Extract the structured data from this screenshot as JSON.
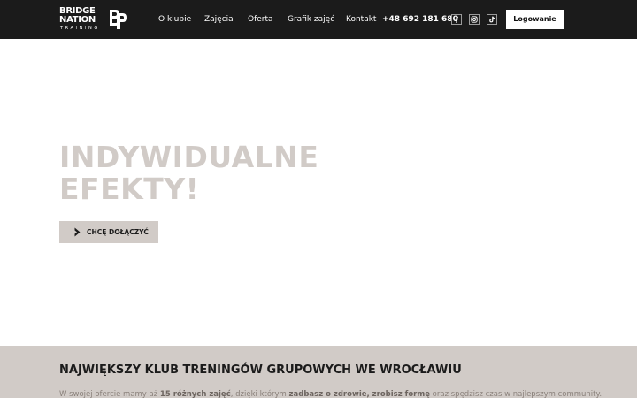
{
  "header": {
    "logo": {
      "line1": "BRIDGE",
      "line2": "NATION",
      "sub": "TRAINING"
    },
    "nav": [
      {
        "label": "O klubie"
      },
      {
        "label": "Zajęcia"
      },
      {
        "label": "Oferta"
      },
      {
        "label": "Grafik zajęć"
      },
      {
        "label": "Kontakt"
      }
    ],
    "phone": "+48 692 181 680",
    "social": [
      {
        "icon": "facebook-icon"
      },
      {
        "icon": "instagram-icon"
      },
      {
        "icon": "tiktok-icon"
      }
    ],
    "login_label": "Logowanie"
  },
  "hero": {
    "title_line1": "INDYWIDUALNE",
    "title_line2": "EFEKTY!",
    "cta_label": "CHCĘ DOŁĄCZYĆ"
  },
  "section": {
    "title": "NAJWIĘKSZY KLUB TRENINGÓW GRUPOWYCH WE WROCŁAWIU",
    "text_1": "W swojej ofercie mamy aż ",
    "text_b1": "15 różnych zajęć",
    "text_2": ", dzięki którym ",
    "text_b2": "zadbasz o zdrowie, zrobisz formę",
    "text_3": " oraz spędzisz czas w najlepszym community."
  },
  "colors": {
    "header_bg": "#1b1b1b",
    "accent_beige": "#d1cbc7",
    "text_dark": "#1b1b1b"
  }
}
